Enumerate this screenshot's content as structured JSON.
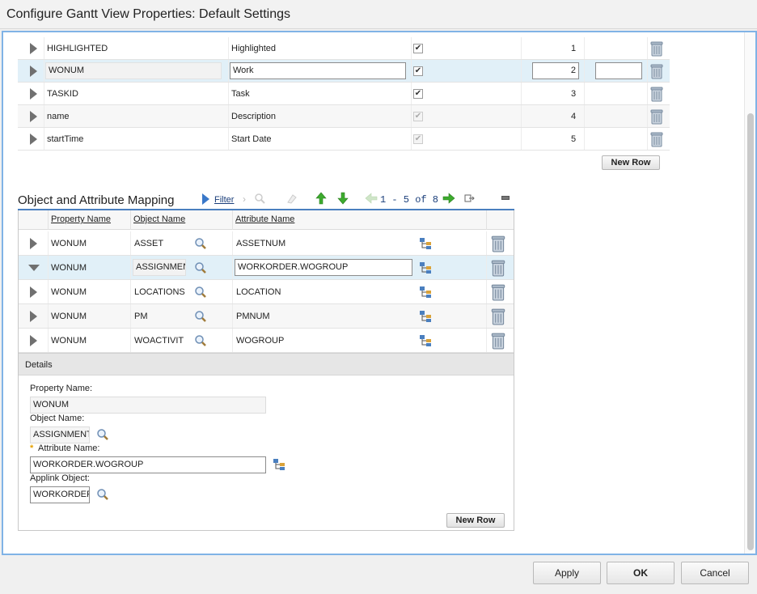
{
  "window": {
    "title": "Configure Gantt View Properties: Default Settings"
  },
  "properties_table": {
    "rows": [
      {
        "attribute": "HIGHLIGHTED",
        "label": "Highlighted",
        "checked": "✔",
        "order": "1"
      },
      {
        "attribute": "WONUM",
        "label": "Work",
        "checked": "✔",
        "order": "2"
      },
      {
        "attribute": "TASKID",
        "label": "Task",
        "checked": "✔",
        "order": "3"
      },
      {
        "attribute": "name",
        "label": "Description",
        "checked": "✔",
        "order": "4"
      },
      {
        "attribute": "startTime",
        "label": "Start Date",
        "checked": "✔",
        "order": "5"
      }
    ],
    "new_row_label": "New Row"
  },
  "mapping": {
    "title": "Object and Attribute Mapping",
    "filter_label": "Filter",
    "pagination": "1 - 5 of 8",
    "columns": {
      "property": "Property Name",
      "object": "Object Name",
      "attribute": "Attribute Name"
    },
    "rows": [
      {
        "property": "WONUM",
        "object": "ASSET",
        "attribute": "ASSETNUM"
      },
      {
        "property": "WONUM",
        "object": "ASSIGNMEN",
        "attribute": "WORKORDER.WOGROUP"
      },
      {
        "property": "WONUM",
        "object": "LOCATIONS",
        "attribute": "LOCATION"
      },
      {
        "property": "WONUM",
        "object": "PM",
        "attribute": "PMNUM"
      },
      {
        "property": "WONUM",
        "object": "WOACTIVIT",
        "attribute": "WOGROUP"
      }
    ],
    "details": {
      "header": "Details",
      "property_label": "Property Name:",
      "property_value": "WONUM",
      "object_label": "Object Name:",
      "object_value": "ASSIGNMENT",
      "attribute_required": "*",
      "attribute_label": "Attribute Name:",
      "attribute_value": "WORKORDER.WOGROUP",
      "applink_label": "Applink Object:",
      "applink_value": "WORKORDER"
    },
    "new_row_label": "New Row"
  },
  "footer": {
    "apply": "Apply",
    "ok": "OK",
    "cancel": "Cancel"
  }
}
